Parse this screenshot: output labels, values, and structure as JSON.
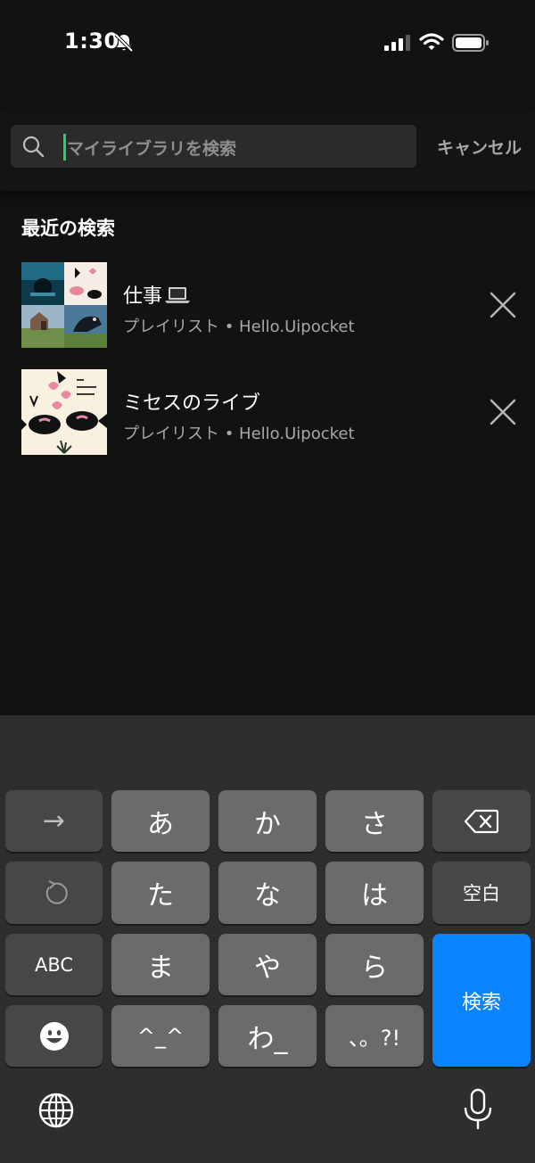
{
  "status_bar": {
    "time": "1:30",
    "icons": [
      "bell-slash-icon",
      "cellular-signal-icon",
      "wifi-icon",
      "battery-icon"
    ]
  },
  "search": {
    "placeholder": "マイライブラリを検索",
    "cancel_label": "キャンセル",
    "caret_color": "#1ed760"
  },
  "recent": {
    "title": "最近の検索",
    "items": [
      {
        "title": "仕事",
        "title_icon": "laptop-emoji",
        "subtitle": "プレイリスト • Hello.Uipocket"
      },
      {
        "title": "ミセスのライブ",
        "subtitle": "プレイリスト • Hello.Uipocket"
      }
    ]
  },
  "keyboard": {
    "keys": {
      "arrow": "→",
      "a": "あ",
      "ka": "か",
      "sa": "さ",
      "ta": "た",
      "na": "な",
      "ha": "は",
      "space": "空白",
      "abc": "ABC",
      "ma": "ま",
      "ya": "や",
      "ra": "ら",
      "search": "検索",
      "emoticon": "^_^",
      "wa": "わ_",
      "punct": "、。?!"
    },
    "icons": [
      "backspace-icon",
      "undo-icon",
      "emoji-face-icon",
      "globe-icon",
      "microphone-icon"
    ],
    "colors": {
      "return_key": "#0a84ff",
      "letter_key": "#6b6b6b",
      "function_key": "#474747"
    }
  },
  "colors": {
    "background": "#121212",
    "search_box": "#2b2b2b",
    "secondary_text": "#a7a7a7"
  }
}
